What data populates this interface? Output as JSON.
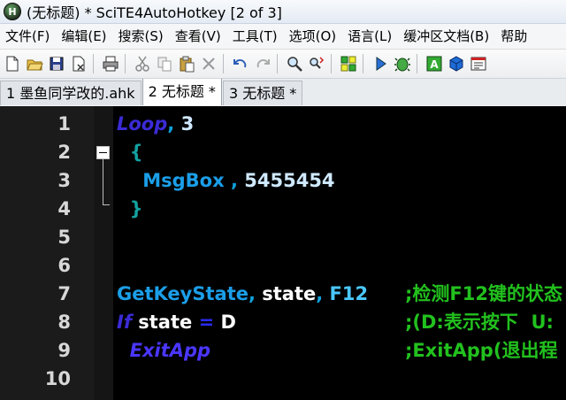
{
  "window": {
    "title": "(无标题) * SciTE4AutoHotkey [2 of 3]",
    "icon_letter": "H"
  },
  "menu": [
    "文件(F)",
    "编辑(E)",
    "搜索(S)",
    "查看(V)",
    "工具(T)",
    "选项(O)",
    "语言(L)",
    "缓冲区文档(B)",
    "帮助"
  ],
  "toolbar_icons": [
    "new-file-icon",
    "open-folder-icon",
    "save-icon",
    "close-file-icon",
    "|",
    "print-icon",
    "|",
    "cut-icon",
    "copy-icon",
    "paste-icon",
    "delete-icon",
    "|",
    "undo-icon",
    "redo-icon",
    "|",
    "find-icon",
    "replace-icon",
    "|",
    "debug-grid-icon",
    "|",
    "run-icon",
    "debug-bug-icon",
    "|",
    "textbox-icon",
    "cube-icon",
    "window-icon"
  ],
  "tabs": [
    {
      "label": "1 墨鱼同学改的.ahk",
      "active": false
    },
    {
      "label": "2 无标题 *",
      "active": true
    },
    {
      "label": "3 无标题 *",
      "active": false
    }
  ],
  "editor": {
    "lines": [
      {
        "n": "1",
        "tokens": [
          {
            "c": "kw",
            "t": "Loop"
          },
          {
            "c": "pun",
            "t": ","
          },
          {
            "c": "num",
            "t": " 3"
          }
        ],
        "comment": ""
      },
      {
        "n": "2",
        "tokens": [
          {
            "c": "brc",
            "t": "  {"
          }
        ],
        "comment": ""
      },
      {
        "n": "3",
        "tokens": [
          {
            "c": "cmd",
            "t": "    MsgBox"
          },
          {
            "c": "pun",
            "t": " ,"
          },
          {
            "c": "num",
            "t": " 5455454"
          }
        ],
        "comment": ""
      },
      {
        "n": "4",
        "tokens": [
          {
            "c": "brc",
            "t": "  }"
          }
        ],
        "comment": ""
      },
      {
        "n": "5",
        "tokens": [],
        "comment": ""
      },
      {
        "n": "6",
        "tokens": [],
        "comment": ""
      },
      {
        "n": "7",
        "tokens": [
          {
            "c": "cmd",
            "t": "GetKeyState"
          },
          {
            "c": "pun",
            "t": ","
          },
          {
            "c": "txt",
            "t": " state"
          },
          {
            "c": "pun",
            "t": ","
          },
          {
            "c": "key",
            "t": " F12"
          }
        ],
        "comment": ";检测F12键的状态"
      },
      {
        "n": "8",
        "tokens": [
          {
            "c": "kw",
            "t": "If"
          },
          {
            "c": "txt",
            "t": " state "
          },
          {
            "c": "op",
            "t": "="
          },
          {
            "c": "txt",
            "t": " D"
          }
        ],
        "comment": ";(D:表示按下  U:"
      },
      {
        "n": "9",
        "tokens": [
          {
            "c": "fn",
            "t": "  ExitApp"
          }
        ],
        "comment": ";ExitApp(退出程"
      },
      {
        "n": "10",
        "tokens": [],
        "comment": ""
      }
    ]
  }
}
